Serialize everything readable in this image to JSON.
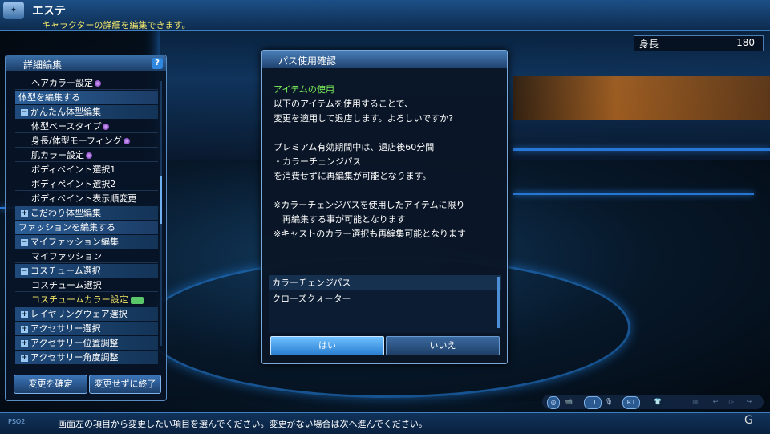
{
  "header": {
    "logo": "✦",
    "title": "エステ",
    "subtitle": "キャラクターの詳細を編集できます。"
  },
  "height_readout": {
    "label": "身長",
    "value": "180"
  },
  "panel": {
    "title": "詳細編集",
    "help": "?",
    "rows": [
      {
        "kind": "item",
        "label": "ヘアカラー設定",
        "gem": true
      },
      {
        "kind": "cat",
        "label": "体型を編集する"
      },
      {
        "kind": "head",
        "sign": "−",
        "label": "かんたん体型編集"
      },
      {
        "kind": "item",
        "label": "体型ベースタイプ",
        "gem": true
      },
      {
        "kind": "item",
        "label": "身長/体型モーフィング",
        "gem": true
      },
      {
        "kind": "item",
        "label": "肌カラー設定",
        "gem": true
      },
      {
        "kind": "item",
        "label": "ボディペイント選択1"
      },
      {
        "kind": "item",
        "label": "ボディペイント選択2"
      },
      {
        "kind": "item",
        "label": "ボディペイント表示順変更"
      },
      {
        "kind": "head",
        "sign": "+",
        "label": "こだわり体型編集"
      },
      {
        "kind": "cat",
        "label": "ファッションを編集する"
      },
      {
        "kind": "head",
        "sign": "−",
        "label": "マイファッション編集"
      },
      {
        "kind": "item",
        "label": "マイファッション"
      },
      {
        "kind": "head",
        "sign": "−",
        "label": "コスチューム選択"
      },
      {
        "kind": "item",
        "label": "コスチューム選択"
      },
      {
        "kind": "item",
        "label": "コスチュームカラー設定",
        "highlight": true,
        "tag": true
      },
      {
        "kind": "head",
        "sign": "+",
        "label": "レイヤリングウェア選択"
      },
      {
        "kind": "head",
        "sign": "+",
        "label": "アクセサリー選択"
      },
      {
        "kind": "head",
        "sign": "+",
        "label": "アクセサリー位置調整"
      },
      {
        "kind": "head",
        "sign": "+",
        "label": "アクセサリー角度調整"
      }
    ],
    "confirm_button": "変更を確定",
    "exit_button": "変更せずに終了"
  },
  "dialog": {
    "title": "パス使用確認",
    "heading": "アイテムの使用",
    "lines1": [
      "以下のアイテムを使用することで、",
      "変更を適用して退店します。よろしいですか?"
    ],
    "lines2": [
      "プレミアム有効期間中は、退店後60分間",
      "・カラーチェンジパス",
      "を消費せずに再編集が可能となります。"
    ],
    "lines3": [
      "※カラーチェンジパスを使用したアイテムに限り",
      "　再編集する事が可能となります",
      "※キャストのカラー選択も再編集可能となります"
    ],
    "list_head": "カラーチェンジパス",
    "list_item": "クローズクォーター",
    "yes": "はい",
    "no": "いいえ"
  },
  "controls": [
    "◎",
    "📹",
    "L1",
    "🎙",
    "R1",
    "👕",
    "▥",
    "↩",
    "▷",
    "↪"
  ],
  "status": {
    "logo": "PSO2",
    "text": "画面左の項目から変更したい項目を選んでください。変更がない場合は次へ進んでください。"
  },
  "watermark": "G"
}
